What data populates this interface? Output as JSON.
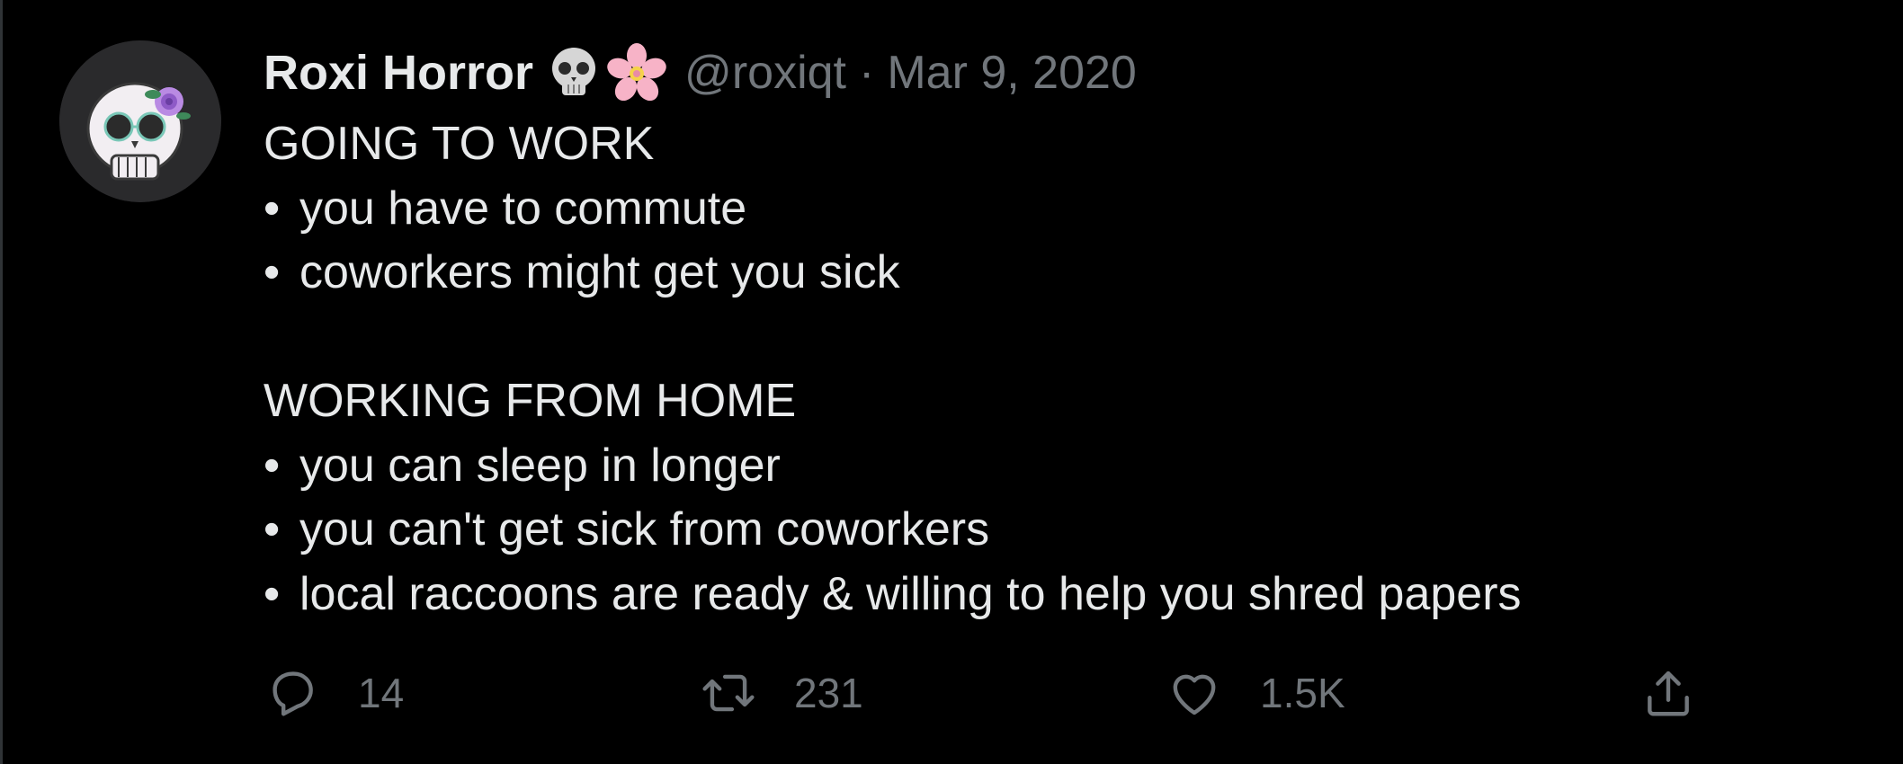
{
  "tweet": {
    "author": {
      "display_name": "Roxi Horror",
      "name_emojis": [
        "skull-emoji",
        "cherry-blossom-emoji"
      ],
      "handle": "@roxiqt",
      "separator": "·",
      "date": "Mar 9, 2020"
    },
    "body": {
      "section1_title": "GOING TO WORK",
      "section1_items": [
        "you have to commute",
        "coworkers might get you sick"
      ],
      "section2_title": "WORKING FROM HOME",
      "section2_items": [
        "you can sleep in longer",
        "you can't get sick from coworkers",
        "local raccoons are ready & willing to help you shred papers"
      ],
      "bullet": "•"
    },
    "actions": {
      "reply_count": "14",
      "retweet_count": "231",
      "like_count": "1.5K"
    }
  },
  "colors": {
    "background": "#000000",
    "primary_text": "#e7e9ea",
    "secondary_text": "#71767b"
  },
  "icons": {
    "reply": "reply-icon",
    "retweet": "retweet-icon",
    "like": "heart-icon",
    "share": "share-icon"
  }
}
